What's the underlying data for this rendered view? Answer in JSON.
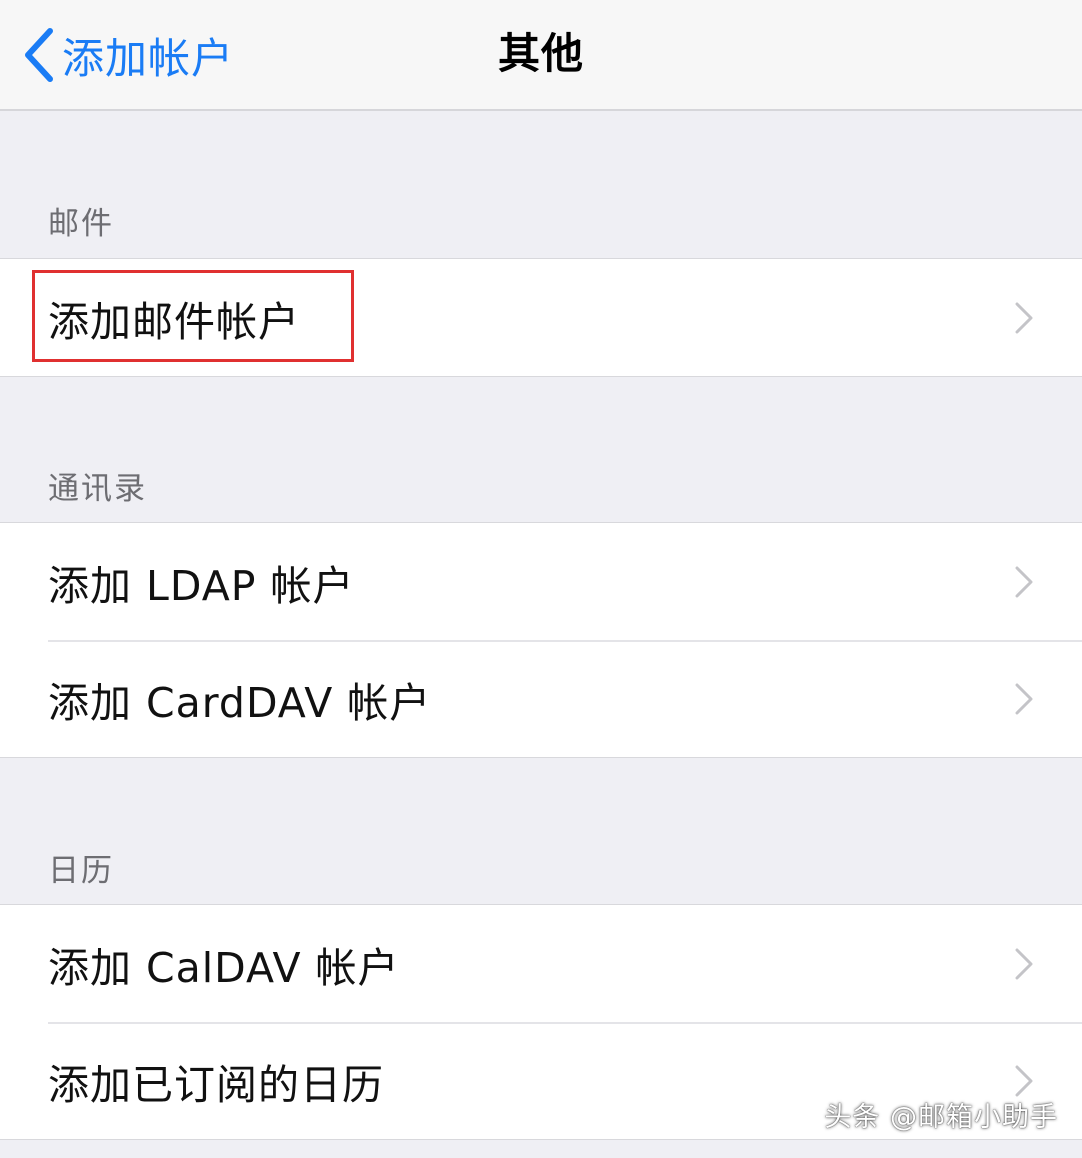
{
  "nav": {
    "back_label": "添加帐户",
    "title": "其他"
  },
  "sections": {
    "mail": {
      "header": "邮件",
      "items": [
        "添加邮件帐户"
      ]
    },
    "contacts": {
      "header": "通讯录",
      "items": [
        "添加 LDAP 帐户",
        "添加 CardDAV 帐户"
      ]
    },
    "calendar": {
      "header": "日历",
      "items": [
        "添加 CalDAV 帐户",
        "添加已订阅的日历"
      ]
    }
  },
  "watermark": "头条 @邮箱小助手",
  "colors": {
    "accent": "#1a7cf5",
    "highlight": "#e03030",
    "background": "#efeff4"
  },
  "icons": {
    "back": "chevron-left-icon",
    "disclosure": "chevron-right-icon"
  }
}
